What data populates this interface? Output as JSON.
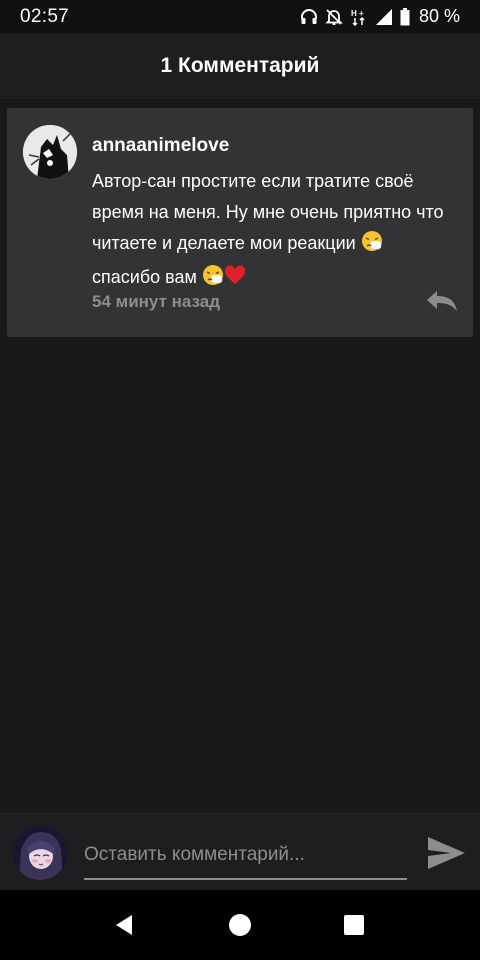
{
  "status_bar": {
    "time": "02:57",
    "battery": "80 %",
    "icons": [
      "headphones-icon",
      "bell-off-icon",
      "data-transfer-icon",
      "signal-icon",
      "battery-icon"
    ]
  },
  "header": {
    "title": "1 Комментарий"
  },
  "comments": [
    {
      "author": "annaanimelove",
      "text_lines": [
        "Автор-сан простите если тратите своё время на меня. Ну мне очень приятно что читаете и делаете мои реакции",
        "спасибо вам"
      ],
      "emojis": [
        "sneezing-face-emoji",
        "sneezing-face-emoji",
        "red-heart-emoji"
      ],
      "time": "54 минут назад",
      "reply_icon": "reply-icon"
    }
  ],
  "composer": {
    "placeholder": "Оставить комментарий...",
    "send_icon": "send-icon"
  },
  "nav_bar": {
    "icons": [
      "back-icon",
      "home-icon",
      "recents-icon"
    ]
  },
  "colors": {
    "background": "#19181a",
    "card": "#333235",
    "muted_text": "#8d8c8f",
    "heart": "#e0202c"
  }
}
